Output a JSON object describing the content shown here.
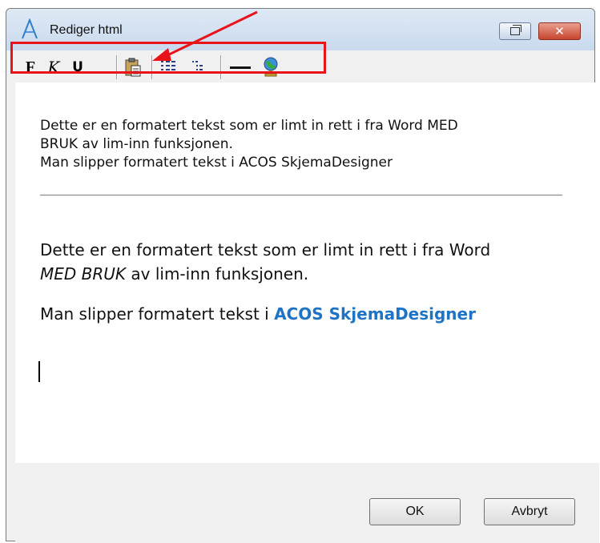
{
  "window": {
    "title": "Rediger html",
    "close_glyph": "✕"
  },
  "toolbar": {
    "bold_label": "F",
    "italic_label": "K",
    "underline_label": "U",
    "icons": [
      "bold-icon",
      "italic-icon",
      "underline-icon",
      "paste-icon",
      "numbered-list-icon",
      "bullet-list-icon",
      "horizontal-rule-icon",
      "globe-link-icon"
    ],
    "highlight_color": "#e8141a"
  },
  "editor": {
    "plain_lines": [
      "Dette er en formatert tekst som er limt in rett i fra Word MED",
      "BRUK av lim-inn funksjonen.",
      "Man slipper formatert tekst i ACOS SkjemaDesigner"
    ],
    "rich_para1_a": "Dette er en formatert tekst som er limt in rett i fra Word",
    "rich_para1_em": "MED BRUK",
    "rich_para1_b": " av lim-inn funksjonen.",
    "rich_para2_a": "Man slipper formatert tekst i ",
    "rich_para2_brand": "ACOS SkjemaDesigner",
    "brand_color": "#1f73c4"
  },
  "footer": {
    "ok_label": "OK",
    "cancel_label": "Avbryt"
  }
}
